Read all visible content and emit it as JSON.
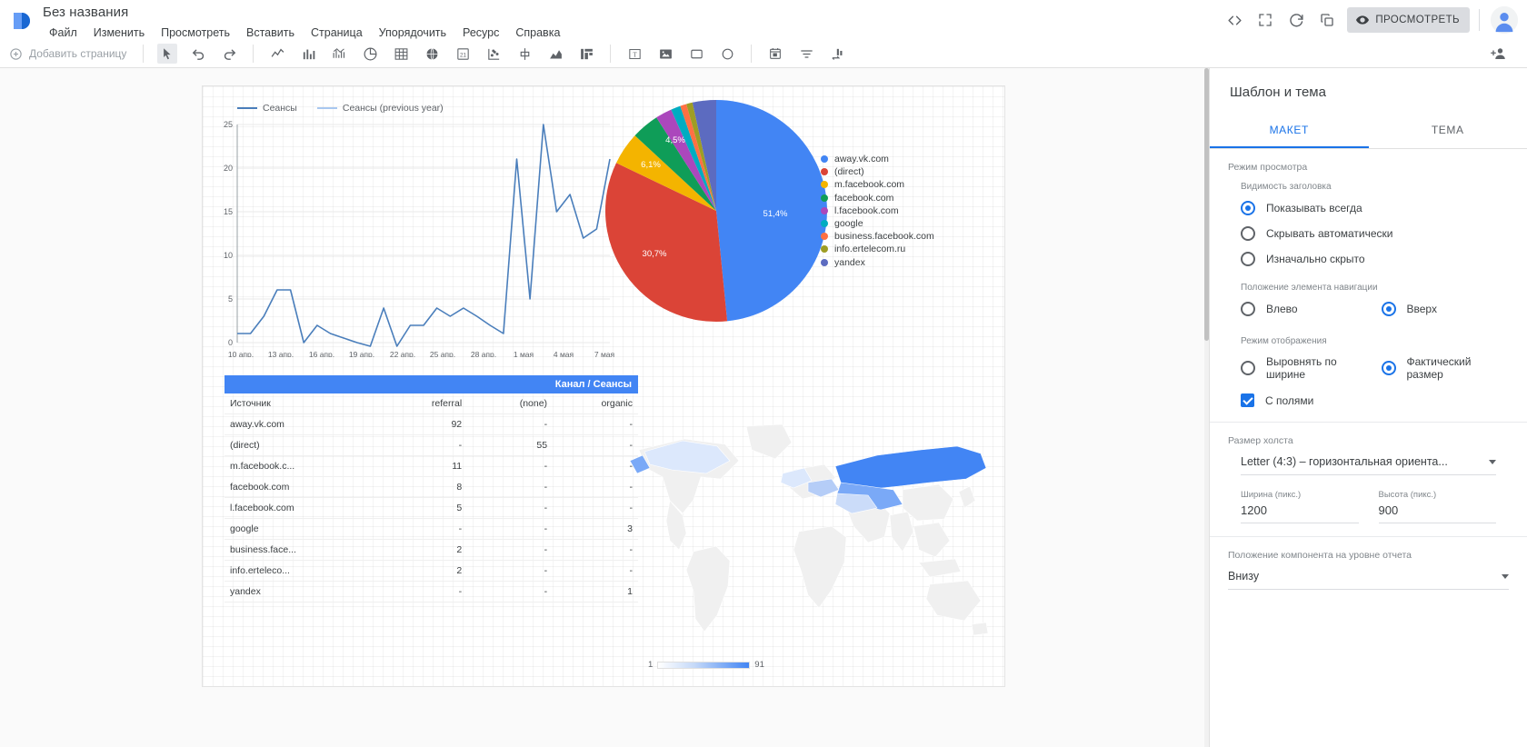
{
  "app": {
    "doc_title": "Без названия",
    "logo_name": "data-studio-logo"
  },
  "menubar": [
    "Файл",
    "Изменить",
    "Просмотреть",
    "Вставить",
    "Страница",
    "Упорядочить",
    "Ресурс",
    "Справка"
  ],
  "top_actions": {
    "embed_label": "embed-code-icon",
    "fullscreen_label": "fullscreen-icon",
    "refresh_label": "refresh-icon",
    "copy_label": "copy-icon",
    "view_label": "ПРОСМОТРЕТЬ"
  },
  "toolbar": {
    "add_page": "Добавить страницу",
    "share_icon": "add-person-icon"
  },
  "chart_data": [
    {
      "type": "line",
      "title": "",
      "legend": [
        {
          "name": "Сеансы",
          "color": "#4a7ebb"
        },
        {
          "name": "Сеансы (previous year)",
          "color": "#a8c7f0"
        }
      ],
      "xlabel": "",
      "ylabel": "",
      "ylim": [
        0,
        25
      ],
      "yticks": [
        0,
        5,
        10,
        15,
        20,
        25
      ],
      "xticks": [
        "10 апр.",
        "13 апр.",
        "16 апр.",
        "19 апр.",
        "22 апр.",
        "25 апр.",
        "28 апр.",
        "1 мая",
        "4 мая",
        "7 мая"
      ],
      "grid": true,
      "series": [
        {
          "name": "Сеансы",
          "values": [
            1,
            1,
            3,
            6,
            6,
            1,
            4,
            3,
            2,
            1,
            0,
            4,
            0,
            2,
            2,
            4,
            3,
            4,
            3,
            2,
            1,
            21,
            5,
            25,
            15,
            17,
            12,
            13,
            21
          ]
        },
        {
          "name": "Сеансы (previous year)",
          "values": []
        }
      ]
    },
    {
      "type": "pie",
      "title": "",
      "labels": [
        "away.vk.com",
        "(direct)",
        "m.facebook.com",
        "facebook.com",
        "l.facebook.com",
        "google",
        "business.facebook.com",
        "info.ertelecom.ru",
        "yandex"
      ],
      "values": [
        51.4,
        30.7,
        6.1,
        4.5,
        2.8,
        1.7,
        1.1,
        1.1,
        0.6
      ],
      "value_labels": [
        "51,4%",
        "30,7%",
        "6,1%",
        "4,5%",
        "",
        "",
        "",
        "",
        ""
      ],
      "colors": [
        "#4285f4",
        "#db4437",
        "#f4b400",
        "#0f9d58",
        "#ab47bc",
        "#00acc1",
        "#ff7043",
        "#9e9d24",
        "#5c6bc0"
      ],
      "legend_position": "right"
    },
    {
      "type": "heatmap",
      "title": "",
      "subtype": "geo-map",
      "legend_min": "1",
      "legend_max": "91",
      "color_low": "#ffffff",
      "color_high": "#4285f4"
    }
  ],
  "table": {
    "header_title": "Канал / Сеансы",
    "columns": [
      "Источник",
      "referral",
      "(none)",
      "organic"
    ],
    "rows": [
      [
        "away.vk.com",
        "92",
        "-",
        "-"
      ],
      [
        "(direct)",
        "-",
        "55",
        "-"
      ],
      [
        "m.facebook.c...",
        "11",
        "-",
        "-"
      ],
      [
        "facebook.com",
        "8",
        "-",
        "-"
      ],
      [
        "l.facebook.com",
        "5",
        "-",
        "-"
      ],
      [
        "google",
        "-",
        "-",
        "3"
      ],
      [
        "business.face...",
        "2",
        "-",
        "-"
      ],
      [
        "info.erteleco...",
        "2",
        "-",
        "-"
      ],
      [
        "yandex",
        "-",
        "-",
        "1"
      ]
    ]
  },
  "panel": {
    "title": "Шаблон и тема",
    "tabs": [
      {
        "label": "МАКЕТ",
        "selected": true
      },
      {
        "label": "ТЕМА",
        "selected": false
      }
    ],
    "view_mode": {
      "section_label": "Режим просмотра",
      "header_visibility_label": "Видимость заголовка",
      "header_options": [
        {
          "label": "Показывать всегда",
          "selected": true
        },
        {
          "label": "Скрывать автоматически",
          "selected": false
        },
        {
          "label": "Изначально скрыто",
          "selected": false
        }
      ],
      "nav_position_label": "Положение элемента навигации",
      "nav_options": [
        {
          "label": "Влево",
          "selected": false
        },
        {
          "label": "Вверх",
          "selected": true
        }
      ],
      "display_mode_label": "Режим отображения",
      "display_options": [
        {
          "label": "Выровнять по ширине",
          "selected": false
        },
        {
          "label": "Фактический размер",
          "selected": true
        }
      ],
      "margins_label": "С полями",
      "margins_checked": true
    },
    "canvas_size": {
      "section_label": "Размер холста",
      "preset_value": "Letter (4:3) – горизонтальная ориента...",
      "width_label": "Ширина (пикс.)",
      "width_value": "1200",
      "height_label": "Высота (пикс.)",
      "height_value": "900"
    },
    "component_position": {
      "section_label": "Положение компонента на уровне отчета",
      "value": "Внизу"
    }
  },
  "colors": {
    "accent": "#1a73e8",
    "table_header": "#4285f4",
    "line": "#4a7ebb"
  }
}
